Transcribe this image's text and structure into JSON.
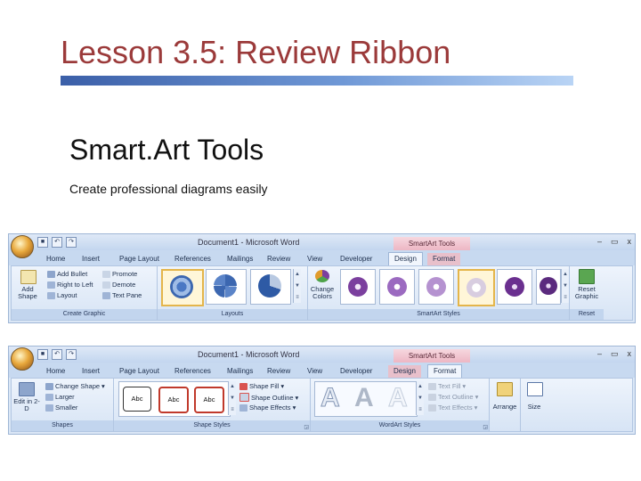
{
  "slide": {
    "title": "Lesson 3.5: Review Ribbon",
    "heading": "Smart.Art Tools",
    "subtext": "Create professional diagrams easily"
  },
  "common": {
    "doc_title": "Document1 - Microsoft Word",
    "context_tab": "SmartArt Tools",
    "window_controls": [
      "–",
      "▭",
      "x"
    ],
    "tabs": [
      "Home",
      "Insert",
      "Page Layout",
      "References",
      "Mailings",
      "Review",
      "View",
      "Developer",
      "Design",
      "Format"
    ]
  },
  "ribbon1": {
    "active_tab": "Design",
    "add_shape": "Add Shape",
    "add_bullet": "Add Bullet",
    "right_to_left": "Right to Left",
    "layout": "Layout",
    "promote": "Promote",
    "demote": "Demote",
    "text_pane": "Text Pane",
    "group_create": "Create Graphic",
    "group_layouts": "Layouts",
    "change_colors": "Change Colors",
    "group_styles": "SmartArt Styles",
    "reset_graphic": "Reset Graphic",
    "group_reset": "Reset"
  },
  "ribbon2": {
    "active_tab": "Format",
    "edit_in_2d": "Edit in 2-D",
    "change_shape": "Change Shape",
    "larger": "Larger",
    "smaller": "Smaller",
    "group_shapes": "Shapes",
    "abc": [
      "Abc",
      "Abc",
      "Abc"
    ],
    "shape_fill": "Shape Fill",
    "shape_outline": "Shape Outline",
    "shape_effects": "Shape Effects",
    "group_shape_styles": "Shape Styles",
    "text_fill": "Text Fill",
    "text_outline": "Text Outline",
    "text_effects": "Text Effects",
    "group_wordart": "WordArt Styles",
    "arrange": "Arrange",
    "size": "Size",
    "bigA": [
      "A",
      "A",
      "A"
    ]
  },
  "colors": {
    "title": "#9b3a3a",
    "accent_purple": "#7b3f9e",
    "context_pink": "#edb7c4",
    "ribbon_blue": "#dbe7f6"
  }
}
